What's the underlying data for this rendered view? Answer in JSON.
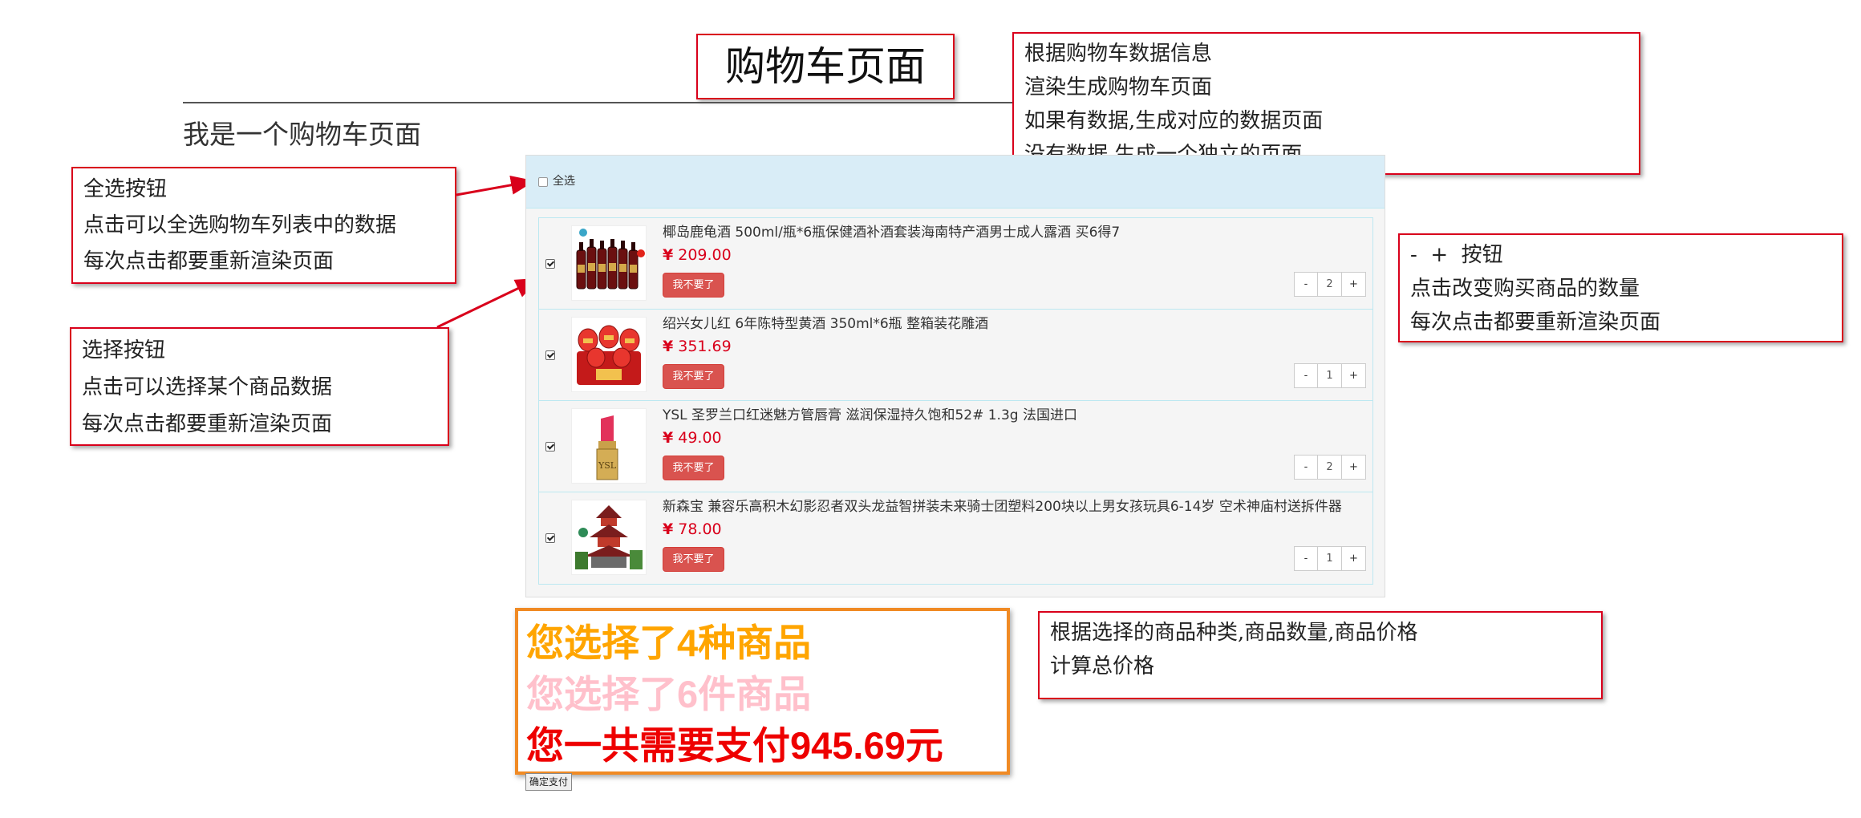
{
  "page_title": "购物车页面",
  "subheading": "我是一个购物车页面",
  "cart": {
    "select_all_label": "全选",
    "items": [
      {
        "name": "椰岛鹿龟酒 500ml/瓶*6瓶保健酒补酒套装海南特产酒男士成人露酒 买6得7",
        "currency": "¥",
        "price": "209.00",
        "delete_label": "我不要了",
        "qty": "2",
        "minus": "-",
        "plus": "+",
        "image": "liquor-bottles-image",
        "checked": true
      },
      {
        "name": "绍兴女儿红 6年陈特型黄酒 350ml*6瓶 整箱装花雕酒",
        "currency": "¥",
        "price": "351.69",
        "delete_label": "我不要了",
        "qty": "1",
        "minus": "-",
        "plus": "+",
        "image": "red-wine-jars-image",
        "checked": true
      },
      {
        "name": "YSL 圣罗兰口红迷魅方管唇膏 滋润保湿持久饱和52# 1.3g 法国进口",
        "currency": "¥",
        "price": "49.00",
        "delete_label": "我不要了",
        "qty": "2",
        "minus": "-",
        "plus": "+",
        "image": "lipstick-image",
        "checked": true
      },
      {
        "name": "新森宝 兼容乐高积木幻影忍者双头龙益智拼装未来骑士团塑料200块以上男女孩玩具6-14岁 空术神庙村送拆件器",
        "currency": "¥",
        "price": "78.00",
        "delete_label": "我不要了",
        "qty": "1",
        "minus": "-",
        "plus": "+",
        "image": "building-blocks-temple-image",
        "checked": true
      }
    ]
  },
  "summary": {
    "kinds_text": "您选择了4种商品",
    "count_text": "您选择了6件商品",
    "total_text": "您一共需要支付945.69元",
    "kinds_color": "#ffa500",
    "count_color": "#ffc0cb",
    "total_color": "#ee0000"
  },
  "pay_button": "确定支付",
  "annotations": {
    "render": [
      "根据购物车数据信息",
      "渲染生成购物车页面",
      "如果有数据,生成对应的数据页面",
      "没有数据,生成一个独立的页面"
    ],
    "select_all": [
      "全选按钮",
      "点击可以全选购物车列表中的数据",
      "每次点击都要重新渲染页面"
    ],
    "select": [
      "选择按钮",
      "点击可以选择某个商品数据",
      "每次点击都要重新渲染页面"
    ],
    "stepper": [
      "-  +  按钮",
      "点击改变购买商品的数量",
      "每次点击都要重新渲染页面"
    ],
    "total": [
      "根据选择的商品种类,商品数量,商品价格",
      "计算总价格"
    ]
  },
  "colors": {
    "annotation_border": "#d9001b",
    "cart_header": "#d9edf7",
    "delete_button": "#d9534f",
    "price": "#d9001b",
    "summary_border": "#f08a24"
  }
}
